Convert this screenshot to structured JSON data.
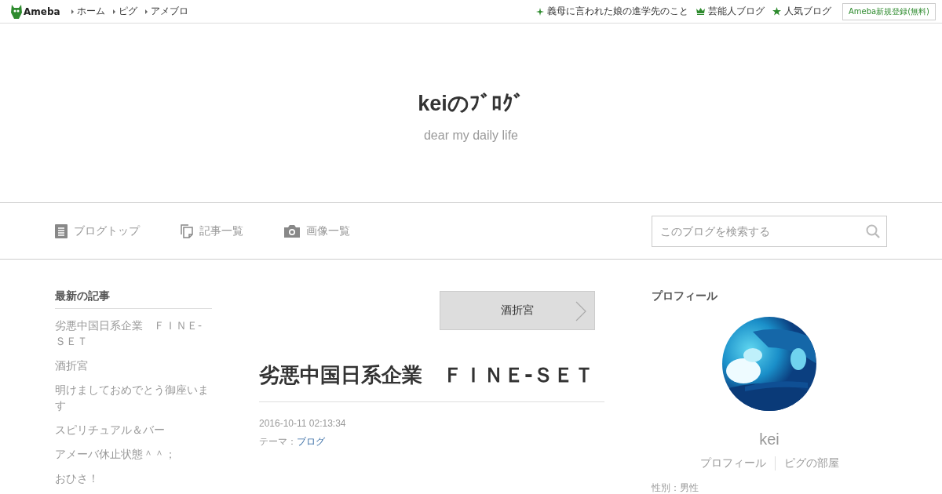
{
  "topbar": {
    "logo": "Ameba",
    "links": [
      "ホーム",
      "ピグ",
      "アメブロ"
    ],
    "right_links": [
      {
        "kind": "sparkle",
        "label": "義母に言われた娘の進学先のこと"
      },
      {
        "kind": "crown",
        "label": "芸能人ブログ"
      },
      {
        "kind": "star",
        "label": "人気ブログ"
      }
    ],
    "register_button": "Ameba新規登録(無料)"
  },
  "header": {
    "title": "keiのﾌﾞﾛｸﾞ",
    "subtitle": "dear my daily life"
  },
  "nav": {
    "items": [
      {
        "kind": "document",
        "label": "ブログトップ"
      },
      {
        "kind": "pages",
        "label": "記事一覧"
      },
      {
        "kind": "camera",
        "label": "画像一覧"
      }
    ],
    "search": {
      "placeholder": "このブログを検索する"
    }
  },
  "recent": {
    "heading": "最新の記事",
    "items": [
      "劣悪中国日系企業　ＦＩＮＥ-ＳＥＴ",
      "酒折宮",
      "明けましておめでとう御座います",
      "スピリチュアル＆バー",
      "アメーバ休止状態＾＾；",
      "おひさ！"
    ]
  },
  "article": {
    "next_button": "酒折宮",
    "title": "劣悪中国日系企業　ＦＩＮＥ-ＳＥＴ",
    "date": "2016-10-11 02:13:34",
    "theme_label": "テーマ：",
    "theme_link": "ブログ"
  },
  "profile": {
    "heading": "プロフィール",
    "avatar": {
      "kind": "picture"
    },
    "name": "kei",
    "links": [
      "プロフィール",
      "ピグの部屋"
    ],
    "info": "性別：男性"
  }
}
